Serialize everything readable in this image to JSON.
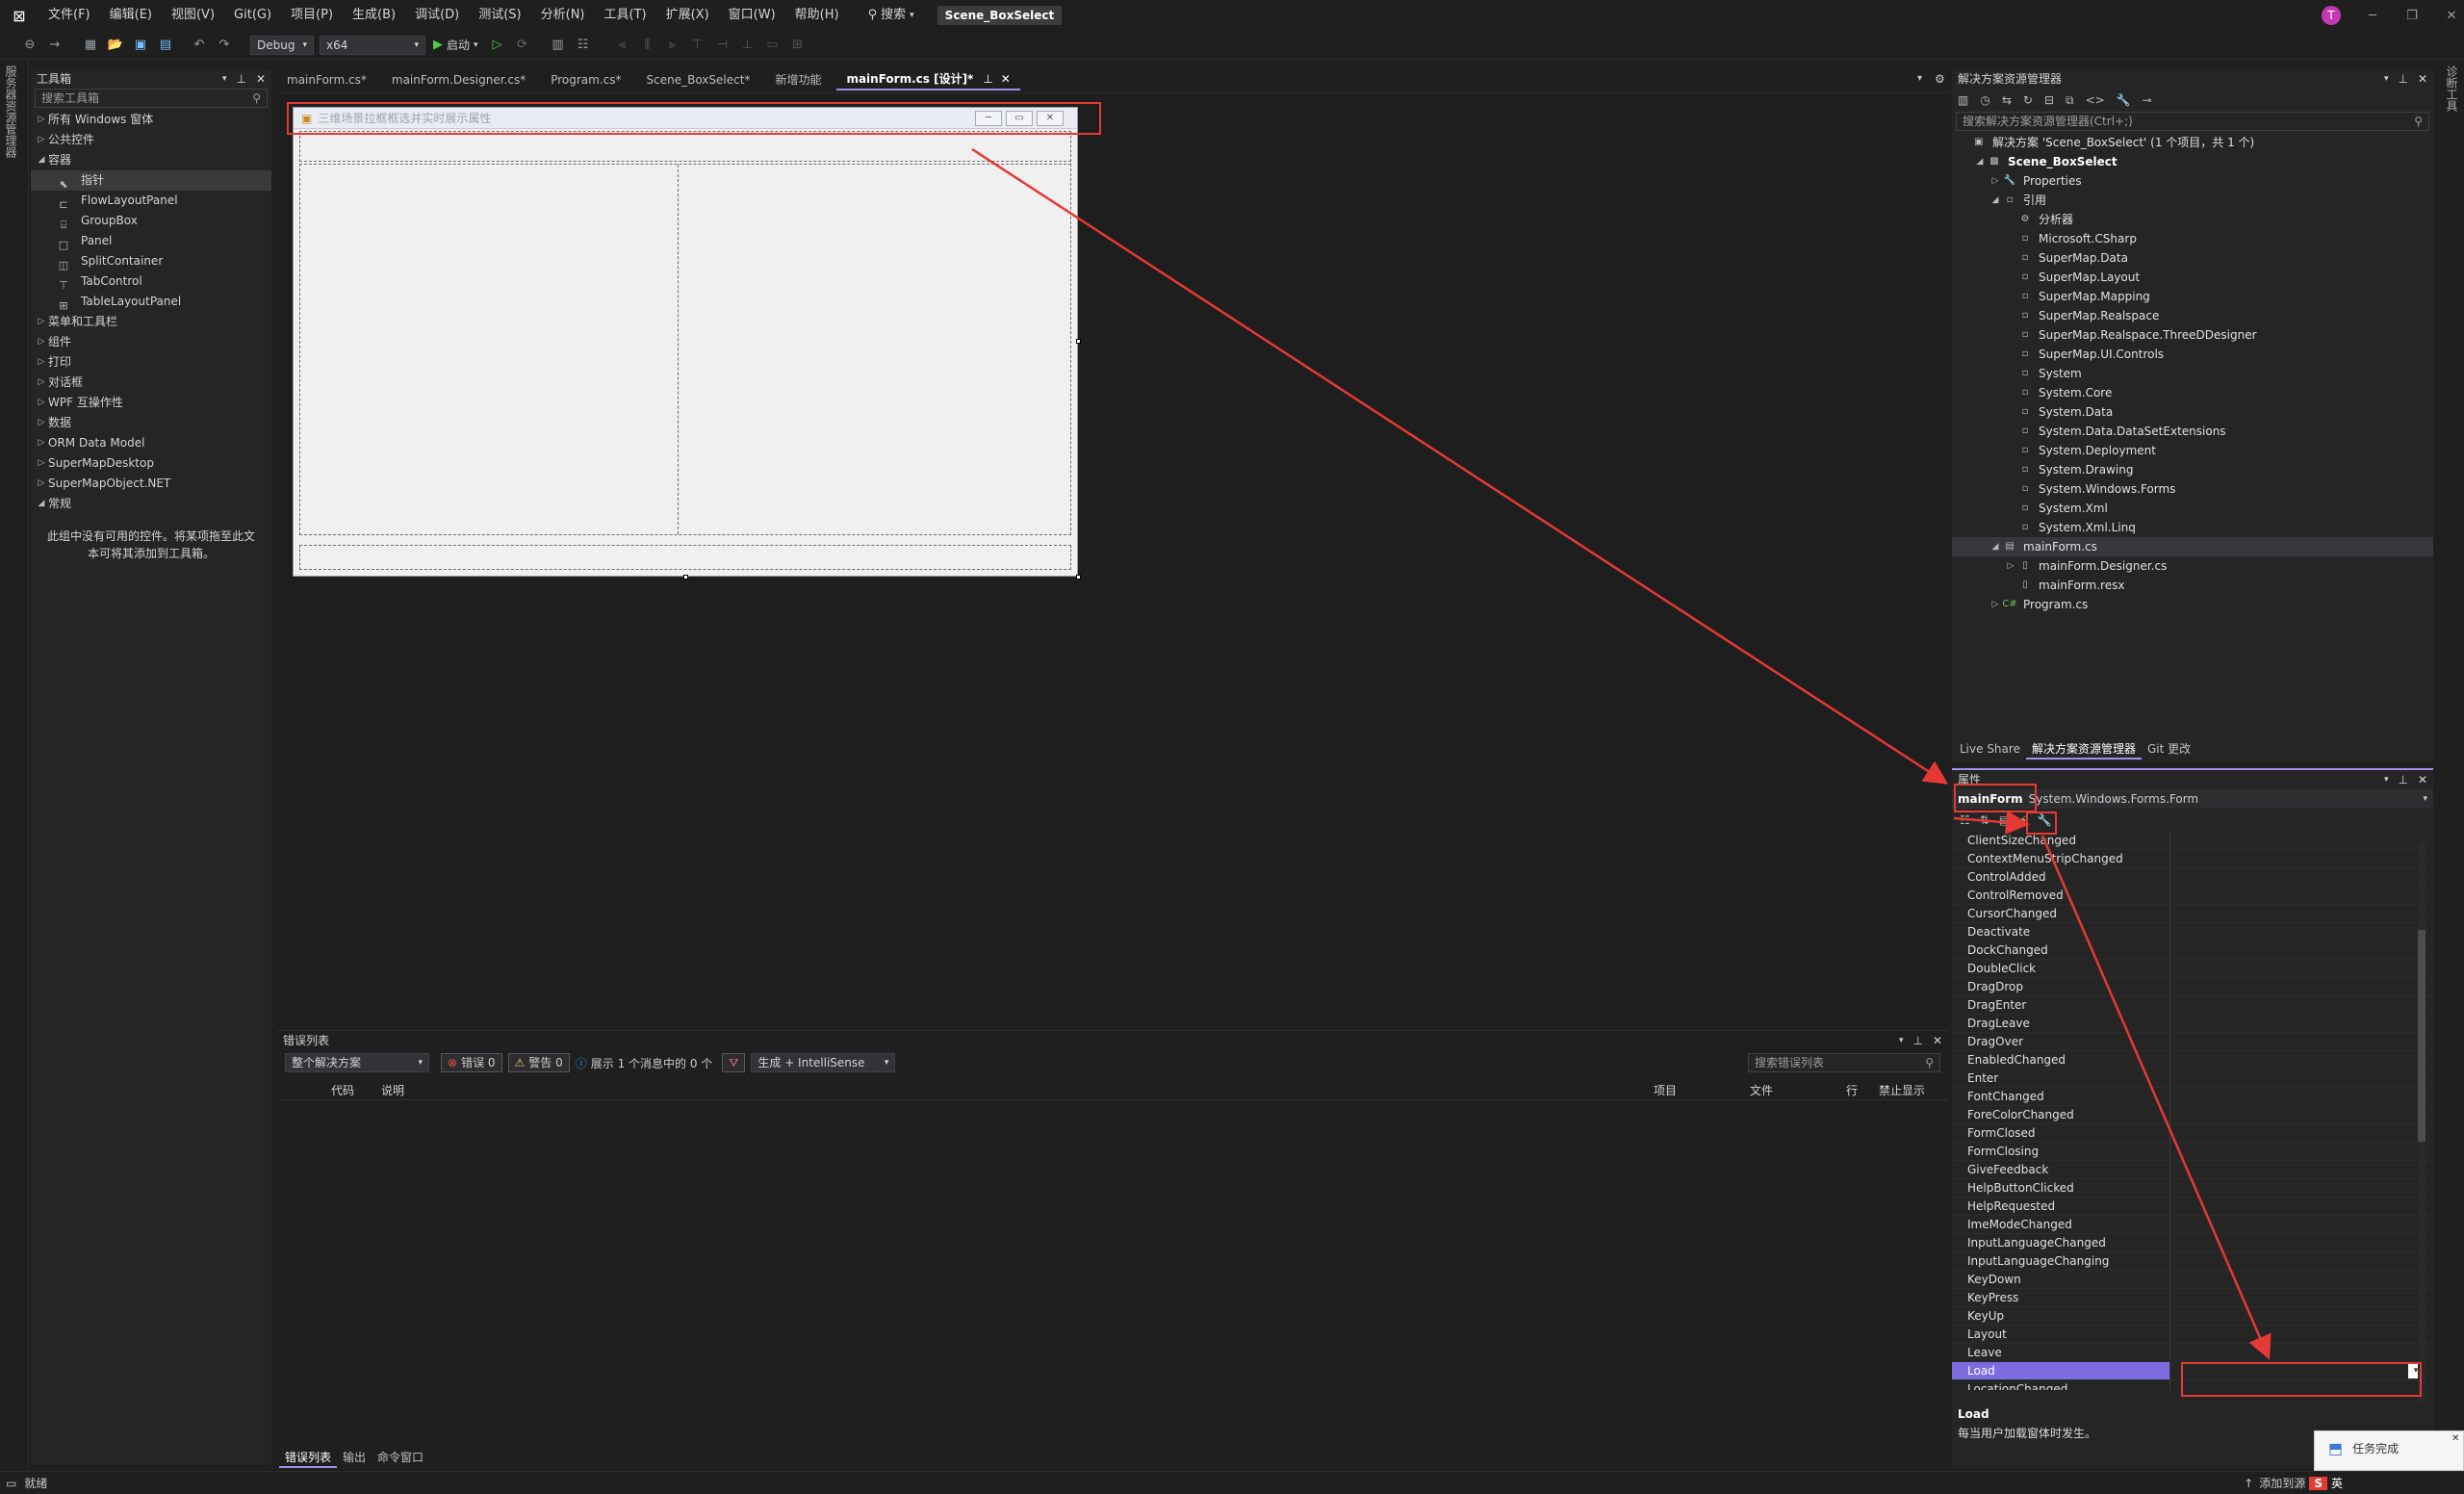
{
  "menubar": {
    "items": [
      "文件(F)",
      "编辑(E)",
      "视图(V)",
      "Git(G)",
      "项目(P)",
      "生成(B)",
      "调试(D)",
      "测试(S)",
      "分析(N)",
      "工具(T)",
      "扩展(X)",
      "窗口(W)",
      "帮助(H)"
    ],
    "search_label": "搜索",
    "solution_name": "Scene_BoxSelect",
    "avatar_initial": "T",
    "live_share": "Live Share"
  },
  "toolbar": {
    "config": "Debug",
    "platform": "x64",
    "start_label": "启动"
  },
  "leftstrip": {
    "label": "服务器资源管理器"
  },
  "rightstrip": {
    "label": "诊断工具"
  },
  "toolbox": {
    "title": "工具箱",
    "search_placeholder": "搜索工具箱",
    "items": [
      {
        "label": "所有 Windows 窗体",
        "type": "group-collapsed"
      },
      {
        "label": "公共控件",
        "type": "group-collapsed"
      },
      {
        "label": "容器",
        "type": "group-expanded"
      },
      {
        "label": "指针",
        "type": "item-selected",
        "icon": "pointer"
      },
      {
        "label": "FlowLayoutPanel",
        "type": "item",
        "icon": "flow"
      },
      {
        "label": "GroupBox",
        "type": "item",
        "icon": "group"
      },
      {
        "label": "Panel",
        "type": "item",
        "icon": "panel"
      },
      {
        "label": "SplitContainer",
        "type": "item",
        "icon": "split"
      },
      {
        "label": "TabControl",
        "type": "item",
        "icon": "tab"
      },
      {
        "label": "TableLayoutPanel",
        "type": "item",
        "icon": "table"
      },
      {
        "label": "菜单和工具栏",
        "type": "group-collapsed"
      },
      {
        "label": "组件",
        "type": "group-collapsed"
      },
      {
        "label": "打印",
        "type": "group-collapsed"
      },
      {
        "label": "对话框",
        "type": "group-collapsed"
      },
      {
        "label": "WPF 互操作性",
        "type": "group-collapsed"
      },
      {
        "label": "数据",
        "type": "group-collapsed"
      },
      {
        "label": "ORM Data Model",
        "type": "group-collapsed"
      },
      {
        "label": "SuperMapDesktop",
        "type": "group-collapsed"
      },
      {
        "label": "SuperMapObject.NET",
        "type": "group-collapsed"
      },
      {
        "label": "常规",
        "type": "group-expanded"
      }
    ],
    "empty_message_line1": "此组中没有可用的控件。将某项拖至此文",
    "empty_message_line2": "本可将其添加到工具箱。"
  },
  "doctabs": {
    "tabs": [
      {
        "label": "mainForm.cs*",
        "active": false
      },
      {
        "label": "mainForm.Designer.cs*",
        "active": false
      },
      {
        "label": "Program.cs*",
        "active": false
      },
      {
        "label": "Scene_BoxSelect*",
        "active": false
      },
      {
        "label": "新增功能",
        "active": false
      },
      {
        "label": "mainForm.cs [设计]*",
        "active": true
      }
    ]
  },
  "form": {
    "title": "三维场景拉框框选并实时展示属性"
  },
  "errorlist": {
    "title": "错误列表",
    "scope": "整个解决方案",
    "errors": "错误 0",
    "warnings": "警告 0",
    "messages": "展示 1 个消息中的 0 个",
    "build_filter": "生成 + IntelliSense",
    "search_placeholder": "搜索错误列表",
    "columns": [
      "代码",
      "说明",
      "项目",
      "文件",
      "行",
      "禁止显示"
    ],
    "bottom_tabs": [
      "错误列表",
      "输出",
      "命令窗口"
    ]
  },
  "solution": {
    "title": "解决方案资源管理器",
    "search_placeholder": "搜索解决方案资源管理器(Ctrl+;)",
    "items": [
      {
        "label": "解决方案 'Scene_BoxSelect' (1 个项目，共 1 个)",
        "indent": 0,
        "tri": "",
        "icon": "sln",
        "bold": false
      },
      {
        "label": "Scene_BoxSelect",
        "indent": 1,
        "tri": "◢",
        "icon": "proj",
        "bold": true
      },
      {
        "label": "Properties",
        "indent": 2,
        "tri": "▷",
        "icon": "wrench",
        "bold": false
      },
      {
        "label": "引用",
        "indent": 2,
        "tri": "◢",
        "icon": "refs",
        "bold": false
      },
      {
        "label": "分析器",
        "indent": 3,
        "tri": "",
        "icon": "ana",
        "bold": false
      },
      {
        "label": "Microsoft.CSharp",
        "indent": 3,
        "tri": "",
        "icon": "ref",
        "bold": false
      },
      {
        "label": "SuperMap.Data",
        "indent": 3,
        "tri": "",
        "icon": "ref",
        "bold": false
      },
      {
        "label": "SuperMap.Layout",
        "indent": 3,
        "tri": "",
        "icon": "ref",
        "bold": false
      },
      {
        "label": "SuperMap.Mapping",
        "indent": 3,
        "tri": "",
        "icon": "ref",
        "bold": false
      },
      {
        "label": "SuperMap.Realspace",
        "indent": 3,
        "tri": "",
        "icon": "ref",
        "bold": false
      },
      {
        "label": "SuperMap.Realspace.ThreeDDesigner",
        "indent": 3,
        "tri": "",
        "icon": "ref",
        "bold": false
      },
      {
        "label": "SuperMap.UI.Controls",
        "indent": 3,
        "tri": "",
        "icon": "ref",
        "bold": false
      },
      {
        "label": "System",
        "indent": 3,
        "tri": "",
        "icon": "ref",
        "bold": false
      },
      {
        "label": "System.Core",
        "indent": 3,
        "tri": "",
        "icon": "ref",
        "bold": false
      },
      {
        "label": "System.Data",
        "indent": 3,
        "tri": "",
        "icon": "ref",
        "bold": false
      },
      {
        "label": "System.Data.DataSetExtensions",
        "indent": 3,
        "tri": "",
        "icon": "ref",
        "bold": false
      },
      {
        "label": "System.Deployment",
        "indent": 3,
        "tri": "",
        "icon": "ref",
        "bold": false
      },
      {
        "label": "System.Drawing",
        "indent": 3,
        "tri": "",
        "icon": "ref",
        "bold": false
      },
      {
        "label": "System.Windows.Forms",
        "indent": 3,
        "tri": "",
        "icon": "ref",
        "bold": false
      },
      {
        "label": "System.Xml",
        "indent": 3,
        "tri": "",
        "icon": "ref",
        "bold": false
      },
      {
        "label": "System.Xml.Linq",
        "indent": 3,
        "tri": "",
        "icon": "ref",
        "bold": false
      },
      {
        "label": "mainForm.cs",
        "indent": 2,
        "tri": "◢",
        "icon": "form",
        "bold": false
      },
      {
        "label": "mainForm.Designer.cs",
        "indent": 3,
        "tri": "▷",
        "icon": "file",
        "bold": false
      },
      {
        "label": "mainForm.resx",
        "indent": 3,
        "tri": "",
        "icon": "file",
        "bold": false
      },
      {
        "label": "Program.cs",
        "indent": 2,
        "tri": "▷",
        "icon": "cs",
        "bold": false
      }
    ],
    "tabs": [
      "Live Share",
      "解决方案资源管理器",
      "Git 更改"
    ]
  },
  "properties": {
    "title": "属性",
    "object_name": "mainForm",
    "object_type": "System.Windows.Forms.Form",
    "events": [
      "ClientSizeChanged",
      "ContextMenuStripChanged",
      "ControlAdded",
      "ControlRemoved",
      "CursorChanged",
      "Deactivate",
      "DockChanged",
      "DoubleClick",
      "DragDrop",
      "DragEnter",
      "DragLeave",
      "DragOver",
      "EnabledChanged",
      "Enter",
      "FontChanged",
      "ForeColorChanged",
      "FormClosed",
      "FormClosing",
      "GiveFeedback",
      "HelpButtonClicked",
      "HelpRequested",
      "ImeModeChanged",
      "InputLanguageChanged",
      "InputLanguageChanging",
      "KeyDown",
      "KeyPress",
      "KeyUp",
      "Layout",
      "Leave",
      "Load",
      "LocationChanged"
    ],
    "selected_event": "Load",
    "desc_title": "Load",
    "desc_text": "每当用户加载窗体时发生。"
  },
  "statusbar": {
    "status": "就绪",
    "add_source": "添加到源",
    "ime_lang": "英"
  },
  "toast": {
    "title": "任务完成"
  },
  "colors": {
    "accent": "#a48fe8",
    "selection": "#7b6de0",
    "annotation": "#e53935"
  }
}
